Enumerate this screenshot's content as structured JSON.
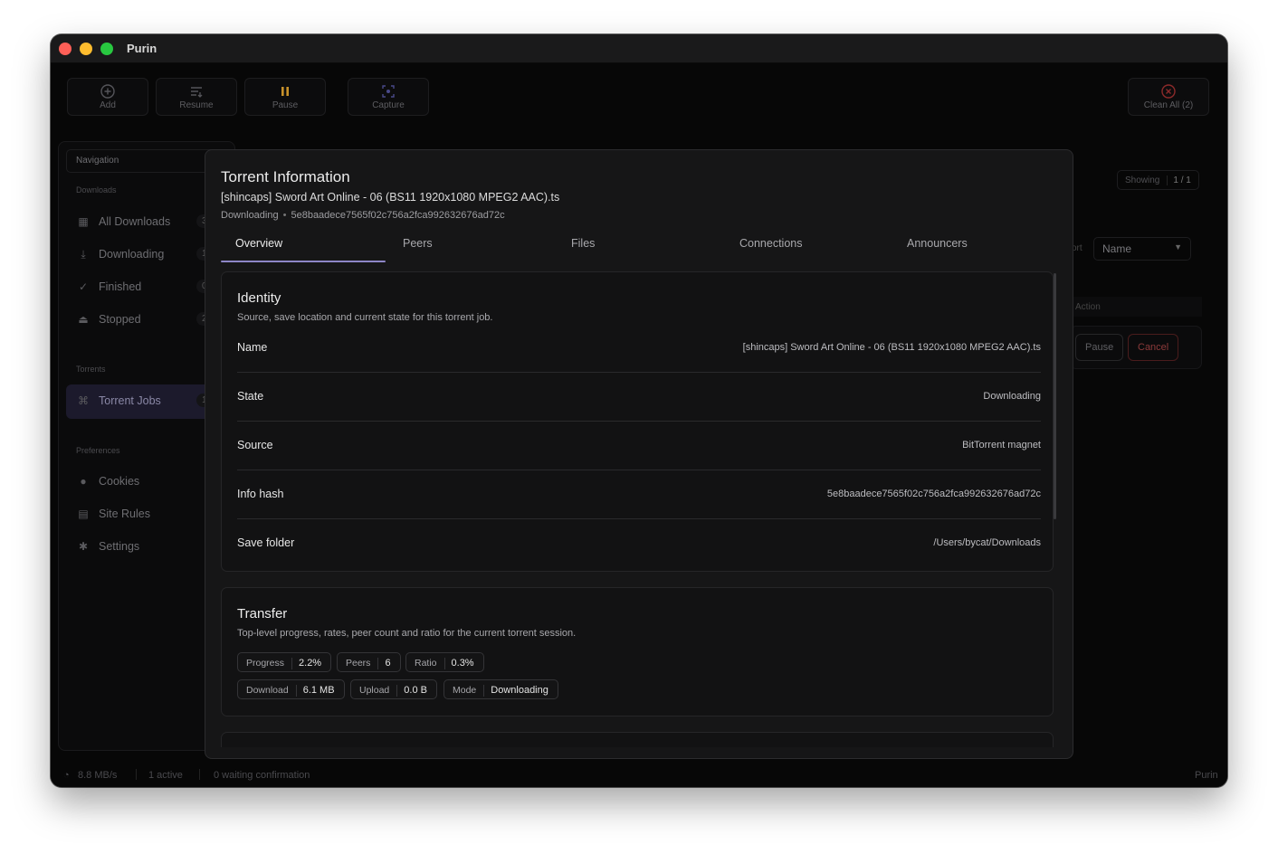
{
  "window": {
    "title": "Purin"
  },
  "toolbar": {
    "add_label": "Add",
    "resume_label": "Resume",
    "pause_label": "Pause",
    "capture_label": "Capture",
    "clean_all_label": "Clean All (2)"
  },
  "sidebar": {
    "nav_placeholder": "Navigation",
    "sections": {
      "downloads": "Downloads",
      "torrents": "Torrents",
      "preferences": "Preferences"
    },
    "items": [
      {
        "label": "All Downloads",
        "count": "3",
        "icon": "grid-icon"
      },
      {
        "label": "Downloading",
        "count": "1",
        "icon": "download-icon"
      },
      {
        "label": "Finished",
        "count": "0",
        "icon": "check-icon"
      },
      {
        "label": "Stopped",
        "count": "2",
        "icon": "stop-icon"
      },
      {
        "label": "Torrent Jobs",
        "count": "1",
        "icon": "torrent-icon"
      },
      {
        "label": "Cookies",
        "icon": "cookie-icon"
      },
      {
        "label": "Site Rules",
        "icon": "rules-icon"
      },
      {
        "label": "Settings",
        "icon": "gear-icon"
      }
    ]
  },
  "main": {
    "showing_label": "Showing",
    "showing_value": "1 / 1",
    "sort_label": "ort",
    "sort_value": "Name",
    "action_header": "Action",
    "row_pause": "Pause",
    "row_cancel": "Cancel"
  },
  "status": {
    "speed": "8.8 MB/s",
    "active": "1 active",
    "waiting": "0 waiting confirmation",
    "app": "Purin"
  },
  "modal": {
    "title": "Torrent Information",
    "filename": "[shincaps] Sword Art Online - 06 (BS11 1920x1080 MPEG2 AAC).ts",
    "state": "Downloading",
    "separator": "•",
    "hash": "5e8baadece7565f02c756a2fca992632676ad72c",
    "tabs": [
      "Overview",
      "Peers",
      "Files",
      "Connections",
      "Announcers"
    ],
    "identity": {
      "title": "Identity",
      "description": "Source, save location and current state for this torrent job.",
      "rows": [
        {
          "key": "Name",
          "value": "[shincaps] Sword Art Online - 06 (BS11 1920x1080 MPEG2 AAC).ts"
        },
        {
          "key": "State",
          "value": "Downloading"
        },
        {
          "key": "Source",
          "value": "BitTorrent magnet"
        },
        {
          "key": "Info hash",
          "value": "5e8baadece7565f02c756a2fca992632676ad72c"
        },
        {
          "key": "Save folder",
          "value": "/Users/bycat/Downloads"
        }
      ]
    },
    "transfer": {
      "title": "Transfer",
      "description": "Top-level progress, rates, peer count and ratio for the current torrent session.",
      "chips": [
        {
          "label": "Progress",
          "value": "2.2%"
        },
        {
          "label": "Peers",
          "value": "6"
        },
        {
          "label": "Ratio",
          "value": "0.3%"
        },
        {
          "label": "Download",
          "value": "6.1 MB"
        },
        {
          "label": "Upload",
          "value": "0.0 B"
        },
        {
          "label": "Mode",
          "value": "Downloading"
        }
      ]
    }
  },
  "colors": {
    "accent": "#8d86c7",
    "close_red": "#fe5f57",
    "minimize_yellow": "#febc2e",
    "zoom_green": "#28c840",
    "pause_orange": "#c8922a",
    "danger": "#8c3a3a"
  }
}
